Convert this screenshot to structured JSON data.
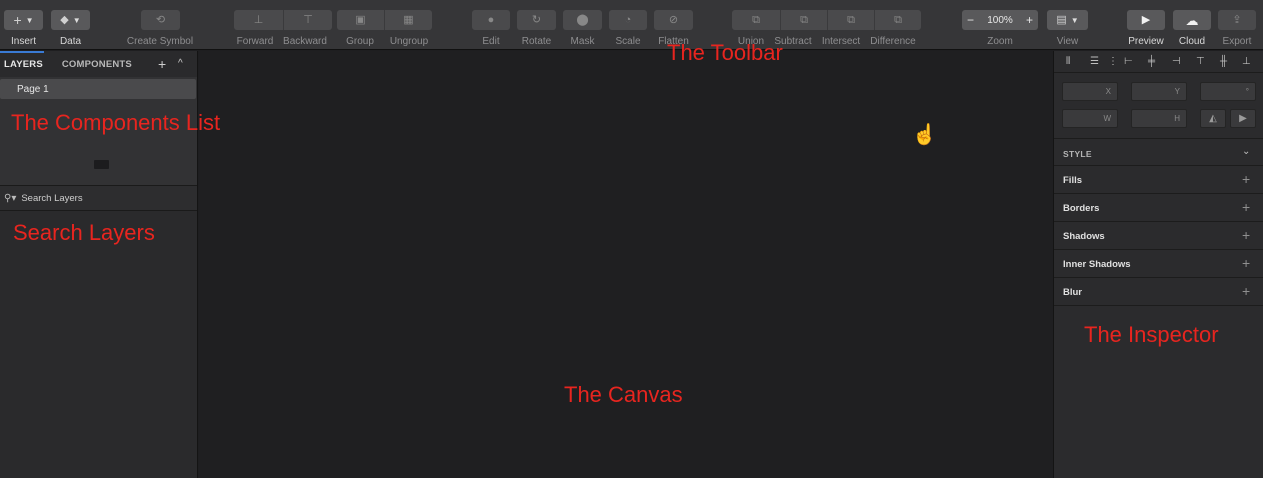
{
  "toolbar": {
    "insert_label": "Insert",
    "data_label": "Data",
    "create_symbol_label": "Create Symbol",
    "forward_label": "Forward",
    "backward_label": "Backward",
    "group_label": "Group",
    "ungroup_label": "Ungroup",
    "edit_label": "Edit",
    "rotate_label": "Rotate",
    "mask_label": "Mask",
    "scale_label": "Scale",
    "flatten_label": "Flatten",
    "union_label": "Union",
    "subtract_label": "Subtract",
    "intersect_label": "Intersect",
    "difference_label": "Difference",
    "zoom_label": "Zoom",
    "zoom_value": "100%",
    "zoom_out": "−",
    "zoom_in": "+",
    "view_label": "View",
    "preview_label": "Preview",
    "cloud_label": "Cloud",
    "export_label": "Export"
  },
  "layers_panel": {
    "tab_layers": "LAYERS",
    "tab_components": "COMPONENTS",
    "add": "+",
    "collapse": "^",
    "pages": [
      {
        "label": "Page 1"
      }
    ],
    "search_placeholder": "Search Layers"
  },
  "inspector": {
    "fields": {
      "x": "X",
      "y": "Y",
      "rotation": "°",
      "w": "W",
      "h": "H"
    },
    "style_title": "STYLE",
    "sections": [
      {
        "label": "Fills"
      },
      {
        "label": "Borders"
      },
      {
        "label": "Shadows"
      },
      {
        "label": "Inner Shadows"
      },
      {
        "label": "Blur"
      }
    ],
    "add": "+"
  },
  "annotations": {
    "toolbar": "The Toolbar",
    "components_list": "The Components List",
    "search_layers": "Search Layers",
    "canvas": "The Canvas",
    "inspector": "The Inspector"
  },
  "colors": {
    "annotation": "#e8251f",
    "tab_underline": "#3a7bd5",
    "toolbar_bg": "#363638",
    "canvas_bg": "#1f1f21"
  },
  "icons": [
    "plus-icon",
    "stack-icon",
    "symbol-icon",
    "forward-icon",
    "backward-icon",
    "group-icon",
    "ungroup-icon",
    "edit-icon",
    "rotate-icon",
    "mask-icon",
    "scale-icon",
    "flatten-icon",
    "union-icon",
    "subtract-icon",
    "intersect-icon",
    "difference-icon",
    "view-icon",
    "play-icon",
    "cloud-icon",
    "share-icon",
    "search-icon",
    "hand-cursor-icon",
    "align-icon",
    "chevron-down-icon"
  ]
}
